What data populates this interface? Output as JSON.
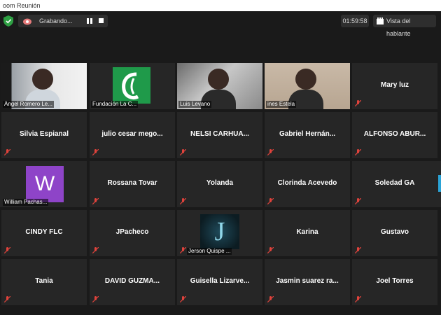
{
  "window": {
    "title": "oom Reunión"
  },
  "topbar": {
    "recording_label": "Grabando...",
    "timer": "01:59:58",
    "speaker_view_label": "Vista del hablante"
  },
  "colors": {
    "active_speaker": "#d8e05a",
    "mute_icon": "#e0433c",
    "shield": "#2ea043"
  },
  "participants": [
    {
      "name": "Ángel Romero Le...",
      "type": "video"
    },
    {
      "name": "Fundación La C...",
      "type": "logo"
    },
    {
      "name": "Luis Levano",
      "type": "video"
    },
    {
      "name": "ines Estela",
      "type": "video"
    },
    {
      "name": "Mary luz",
      "type": "name"
    },
    {
      "name": "Silvia Espianal",
      "type": "name"
    },
    {
      "name": "julio cesar mego...",
      "type": "name"
    },
    {
      "name": "NELSI CARHUA...",
      "type": "name"
    },
    {
      "name": "Gabriel Hernán...",
      "type": "name"
    },
    {
      "name": "ALFONSO ABUR...",
      "type": "name"
    },
    {
      "name": "William Pachas...",
      "type": "avatar",
      "initial": "W"
    },
    {
      "name": "Rossana Tovar",
      "type": "name"
    },
    {
      "name": "Yolanda",
      "type": "name"
    },
    {
      "name": "Clorinda Acevedo",
      "type": "name"
    },
    {
      "name": "Soledad GA",
      "type": "name"
    },
    {
      "name": "CINDY FLC",
      "type": "name"
    },
    {
      "name": "JPacheco",
      "type": "name"
    },
    {
      "name": "Jerson Quispe ...",
      "type": "avatar-j",
      "initial": "J"
    },
    {
      "name": "Karina",
      "type": "name"
    },
    {
      "name": "Gustavo",
      "type": "name"
    },
    {
      "name": "Tania",
      "type": "name"
    },
    {
      "name": "DAVID GUZMA...",
      "type": "name"
    },
    {
      "name": "Guisella Lizarve...",
      "type": "name"
    },
    {
      "name": "Jasmin suarez ra...",
      "type": "name"
    },
    {
      "name": "Joel Torres",
      "type": "name"
    }
  ]
}
